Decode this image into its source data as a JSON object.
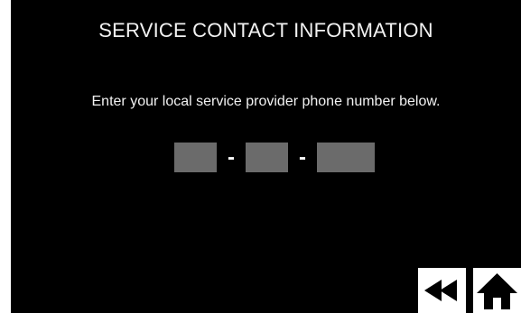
{
  "screen": {
    "title": "SERVICE CONTACT INFORMATION",
    "instruction": "Enter your local service provider phone number below."
  },
  "phone": {
    "area_code": "",
    "prefix": "",
    "line_number": "",
    "separator": "-"
  },
  "nav": {
    "back_icon": "rewind-icon",
    "home_icon": "home-icon"
  },
  "colors": {
    "background": "#000000",
    "text": "#ffffff",
    "field": "#6b6b6b",
    "button": "#ffffff"
  }
}
